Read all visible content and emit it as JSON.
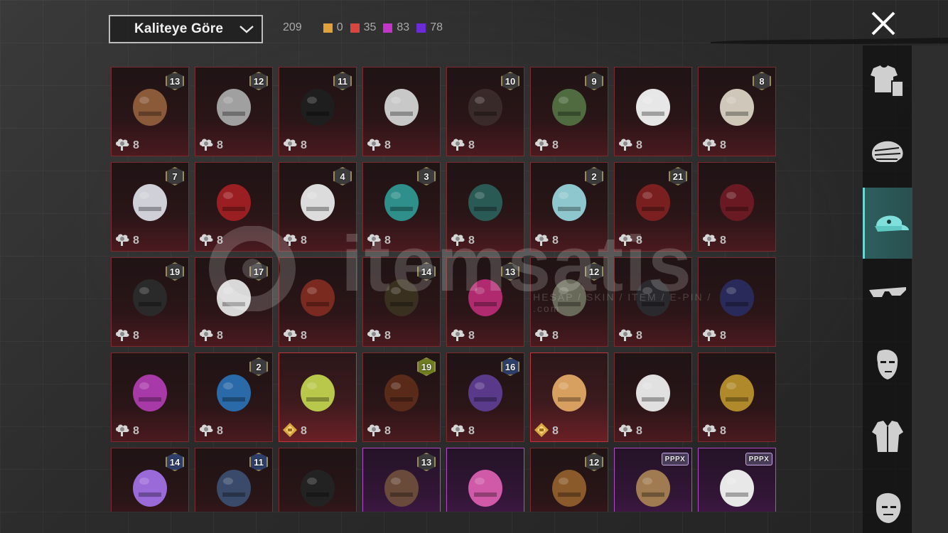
{
  "sort": {
    "label": "Kaliteye Göre"
  },
  "counts": {
    "total": "209",
    "items": [
      {
        "color": "#e0a03a",
        "value": "0"
      },
      {
        "color": "#d9463f",
        "value": "35"
      },
      {
        "color": "#c335c9",
        "value": "83"
      },
      {
        "color": "#6b2bd6",
        "value": "78"
      }
    ]
  },
  "watermark": {
    "text": "itemsatis",
    "sub": "HESAP / SKIN / ITEM / E-PIN / .com"
  },
  "sidebar": {
    "items": [
      {
        "name": "outfit-icon",
        "active": false
      },
      {
        "name": "face-mask-icon",
        "active": false
      },
      {
        "name": "cap-icon",
        "active": true
      },
      {
        "name": "glasses-icon",
        "active": false
      },
      {
        "name": "face-icon",
        "active": false
      },
      {
        "name": "jacket-icon",
        "active": false
      },
      {
        "name": "head-icon",
        "active": false
      }
    ]
  },
  "items": [
    {
      "badge": "13",
      "qty": "8",
      "tier": "red",
      "currency": "cloud",
      "color": "#8a5a3a"
    },
    {
      "badge": "12",
      "qty": "8",
      "tier": "red",
      "currency": "cloud",
      "color": "#a0a0a0"
    },
    {
      "badge": "11",
      "qty": "8",
      "tier": "red",
      "currency": "cloud",
      "color": "#1e1e1e"
    },
    {
      "badge": "",
      "qty": "8",
      "tier": "red",
      "currency": "cloud",
      "color": "#c8c8c8"
    },
    {
      "badge": "10",
      "qty": "8",
      "tier": "red",
      "currency": "cloud",
      "color": "#3a2a2a"
    },
    {
      "badge": "9",
      "qty": "8",
      "tier": "red",
      "currency": "cloud",
      "color": "#4f6b3f"
    },
    {
      "badge": "",
      "qty": "8",
      "tier": "red",
      "currency": "cloud",
      "color": "#e6e6e6"
    },
    {
      "badge": "8",
      "qty": "8",
      "tier": "red",
      "currency": "cloud",
      "color": "#cfc7b8"
    },
    {
      "badge": "7",
      "qty": "8",
      "tier": "red",
      "currency": "cloud",
      "color": "#d0d0d8"
    },
    {
      "badge": "",
      "qty": "8",
      "tier": "red",
      "currency": "cloud",
      "color": "#9a1f22"
    },
    {
      "badge": "4",
      "qty": "8",
      "tier": "red",
      "currency": "cloud",
      "color": "#dcdcdc"
    },
    {
      "badge": "3",
      "qty": "8",
      "tier": "red",
      "currency": "cloud",
      "color": "#2f8f8a"
    },
    {
      "badge": "",
      "qty": "8",
      "tier": "red",
      "currency": "cloud",
      "color": "#2a5a55"
    },
    {
      "badge": "2",
      "qty": "8",
      "tier": "red",
      "currency": "cloud",
      "color": "#8fc7cf"
    },
    {
      "badge": "21",
      "qty": "8",
      "tier": "red",
      "currency": "cloud",
      "color": "#7a2020"
    },
    {
      "badge": "",
      "qty": "8",
      "tier": "red",
      "currency": "cloud",
      "color": "#6a1a22"
    },
    {
      "badge": "19",
      "qty": "8",
      "tier": "red",
      "currency": "cloud",
      "color": "#2a2a2a"
    },
    {
      "badge": "17",
      "qty": "8",
      "tier": "red",
      "currency": "cloud",
      "color": "#d8d8d8"
    },
    {
      "badge": "",
      "qty": "8",
      "tier": "red",
      "currency": "cloud",
      "color": "#7a2a20"
    },
    {
      "badge": "14",
      "qty": "8",
      "tier": "red",
      "currency": "cloud",
      "color": "#3a3020"
    },
    {
      "badge": "13",
      "qty": "8",
      "tier": "red",
      "currency": "cloud",
      "color": "#b02a70"
    },
    {
      "badge": "12",
      "qty": "8",
      "tier": "red",
      "currency": "cloud",
      "color": "#6a6a5a"
    },
    {
      "badge": "",
      "qty": "8",
      "tier": "red",
      "currency": "cloud",
      "color": "#2a2a2e"
    },
    {
      "badge": "",
      "qty": "8",
      "tier": "red",
      "currency": "cloud",
      "color": "#2a2a5a"
    },
    {
      "badge": "",
      "qty": "8",
      "tier": "red",
      "currency": "cloud",
      "color": "#a83aa8"
    },
    {
      "badge": "2",
      "qty": "8",
      "tier": "red",
      "currency": "cloud",
      "color": "#2a6aa8"
    },
    {
      "badge": "",
      "qty": "8",
      "tier": "gold",
      "currency": "coin",
      "color": "#b8c84a"
    },
    {
      "badge": "19",
      "qty": "8",
      "tier": "red",
      "currency": "cloud",
      "color": "#5a2a1a",
      "badgeColor": "green"
    },
    {
      "badge": "16",
      "qty": "8",
      "tier": "red",
      "currency": "cloud",
      "color": "#5a3a8a",
      "badgeColor": "blue"
    },
    {
      "badge": "",
      "qty": "8",
      "tier": "gold",
      "currency": "coin",
      "color": "#d8a060"
    },
    {
      "badge": "",
      "qty": "8",
      "tier": "red",
      "currency": "cloud",
      "color": "#e0e0e0"
    },
    {
      "badge": "",
      "qty": "8",
      "tier": "red",
      "currency": "cloud",
      "color": "#b08a2a"
    },
    {
      "badge": "14",
      "qty": "",
      "tier": "red",
      "currency": "",
      "color": "#9a6ad8",
      "badgeColor": "blue"
    },
    {
      "badge": "11",
      "qty": "",
      "tier": "red",
      "currency": "",
      "color": "#3a4a6a",
      "badgeColor": "blue"
    },
    {
      "badge": "",
      "qty": "",
      "tier": "red",
      "currency": "",
      "color": "#222"
    },
    {
      "badge": "13",
      "qty": "",
      "tier": "purple",
      "currency": "",
      "color": "#6a4a3a"
    },
    {
      "badge": "",
      "qty": "",
      "tier": "purple",
      "currency": "",
      "color": "#d05aa8"
    },
    {
      "badge": "12",
      "qty": "",
      "tier": "red",
      "currency": "",
      "color": "#8a5a2a"
    },
    {
      "badge": "PPPX",
      "qty": "",
      "tier": "purple",
      "currency": "",
      "color": "#a07a50",
      "badgeColor": "ppp"
    },
    {
      "badge": "PPPX",
      "qty": "",
      "tier": "purple",
      "currency": "",
      "color": "#e8e8e8",
      "badgeColor": "ppp"
    }
  ]
}
